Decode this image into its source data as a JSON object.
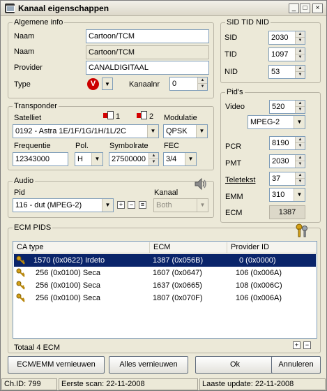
{
  "window": {
    "title": "Kanaal eigenschappen"
  },
  "general": {
    "legend": "Algemene info",
    "naam_label": "Naam",
    "naam_value": "Cartoon/TCM",
    "naam2_label": "Naam",
    "naam2_value": "Cartoon/TCM",
    "provider_label": "Provider",
    "provider_value": "CANALDIGITAAL",
    "type_label": "Type",
    "type_value": "V",
    "kanaalnr_label": "Kanaalnr",
    "kanaalnr_value": "0"
  },
  "sid": {
    "legend": "SID TID NID",
    "sid_label": "SID",
    "sid_value": "2030",
    "tid_label": "TID",
    "tid_value": "1097",
    "nid_label": "NID",
    "nid_value": "53"
  },
  "pids": {
    "legend": "Pid's",
    "video_label": "Video",
    "video_value": "520",
    "video_codec": "MPEG-2",
    "pcr_label": "PCR",
    "pcr_value": "8190",
    "pmt_label": "PMT",
    "pmt_value": "2030",
    "teletekst_label": "Teletekst",
    "teletekst_value": "37",
    "emm_label": "EMM",
    "emm_value": "310",
    "ecm_label": "ECM",
    "ecm_value": "1387"
  },
  "transponder": {
    "legend": "Transponder",
    "satelliet_label": "Satelliet",
    "satelliet_value": "0192 - Astra 1E/1F/1G/1H/1L/2C",
    "tp1_label": "1",
    "tp2_label": "2",
    "modulatie_label": "Modulatie",
    "modulatie_value": "QPSK",
    "frequentie_label": "Frequentie",
    "frequentie_value": "12343000",
    "pol_label": "Pol.",
    "pol_value": "H",
    "symbolrate_label": "Symbolrate",
    "symbolrate_value": "27500000",
    "fec_label": "FEC",
    "fec_value": "3/4"
  },
  "audio": {
    "legend": "Audio",
    "pid_label": "Pid",
    "pid_value": "116 - dut (MPEG-2)",
    "kanaal_label": "Kanaal",
    "kanaal_value": "Both"
  },
  "ecm": {
    "legend": "ECM PIDS",
    "columns": [
      "CA type",
      "ECM",
      "Provider ID"
    ],
    "rows": [
      {
        "ca": "1570  (0x0622) Irdeto",
        "ecm": "1387  (0x056B)",
        "prov": "0  (0x0000)"
      },
      {
        "ca": "256  (0x0100) Seca",
        "ecm": "1607  (0x0647)",
        "prov": "106  (0x006A)"
      },
      {
        "ca": "256  (0x0100) Seca",
        "ecm": "1637  (0x0665)",
        "prov": "108  (0x006C)"
      },
      {
        "ca": "256  (0x0100) Seca",
        "ecm": "1807  (0x070F)",
        "prov": "106  (0x006A)"
      }
    ],
    "total": "Totaal 4 ECM"
  },
  "buttons": {
    "ecm_emm": "ECM/EMM vernieuwen",
    "alles": "Alles vernieuwen",
    "ok": "Ok",
    "annuleren": "Annuleren"
  },
  "status": {
    "chid": "Ch.ID: 799",
    "eerste": "Eerste scan: 22-11-2008",
    "laatste": "Laaste update: 22-11-2008"
  }
}
